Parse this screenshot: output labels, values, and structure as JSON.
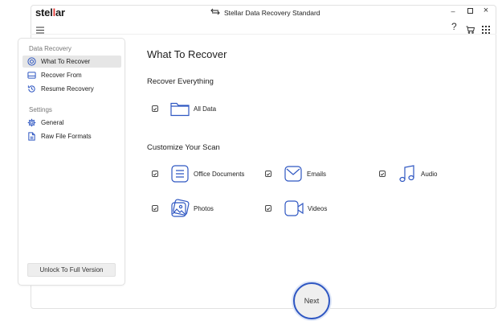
{
  "app": {
    "logo_prefix": "stel",
    "logo_accent": "l",
    "logo_suffix": "ar",
    "title": "Stellar Data Recovery Standard"
  },
  "window_controls": {
    "minimize": "–",
    "maximize": "☐",
    "close": "×"
  },
  "toolbar": {
    "help": "?"
  },
  "sidebar": {
    "section1": "Data Recovery",
    "items1": [
      {
        "label": "What To Recover",
        "icon": "target-icon",
        "active": true
      },
      {
        "label": "Recover From",
        "icon": "drive-icon"
      },
      {
        "label": "Resume Recovery",
        "icon": "history-icon"
      }
    ],
    "section2": "Settings",
    "items2": [
      {
        "label": "General",
        "icon": "gear-icon"
      },
      {
        "label": "Raw File Formats",
        "icon": "file-formats-icon"
      }
    ],
    "unlock_label": "Unlock To Full Version"
  },
  "main": {
    "title": "What To Recover",
    "recover_everything": "Recover Everything",
    "all_data": "All Data",
    "customize": "Customize Your Scan",
    "options": {
      "office": "Office Documents",
      "emails": "Emails",
      "audio": "Audio",
      "photos": "Photos",
      "videos": "Videos"
    }
  },
  "next_label": "Next",
  "colors": {
    "accent": "#2f57c2",
    "logo_accent": "#e53935"
  }
}
